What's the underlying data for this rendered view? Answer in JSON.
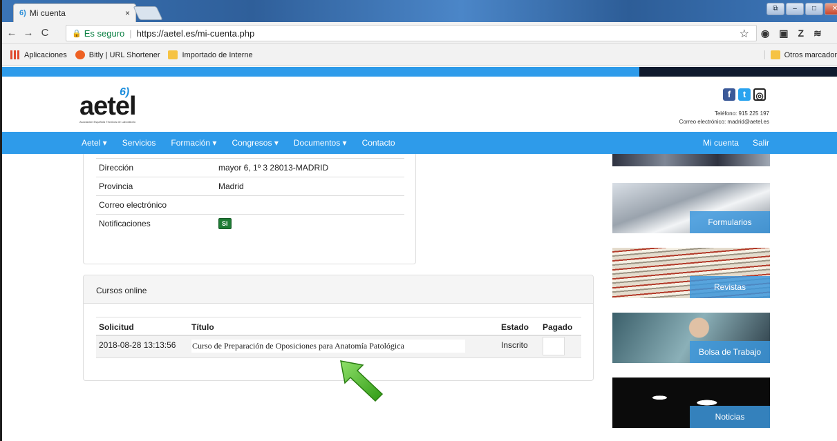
{
  "browser": {
    "tab_title": "Mi cuenta",
    "tab_close": "×",
    "secure_label": "Es seguro",
    "url": "https://aetel.es/mi-cuenta.php",
    "bookmarks": [
      "Aplicaciones",
      "Bitly | URL Shortener",
      "Importado de Interne"
    ],
    "other_bookmarks": "Otros marcador"
  },
  "header": {
    "logo_text": "aetel",
    "logo_mark": "6)",
    "logo_subtitle": "Asociación Española Técnicos de Laboratorio",
    "phone": "Teléfono: 915 225 197",
    "email": "Correo electrónico: madrid@aetel.es"
  },
  "nav": {
    "items": [
      "Aetel ▾",
      "Servicios",
      "Formación ▾",
      "Congresos ▾",
      "Documentos ▾",
      "Contacto"
    ],
    "right": [
      "Mi cuenta",
      "Salir"
    ]
  },
  "profile": {
    "rows": [
      {
        "label": "Dirección",
        "value": "mayor 6, 1º 3 28013-MADRID"
      },
      {
        "label": "Provincia",
        "value": "Madrid"
      },
      {
        "label": "Correo electrónico",
        "value": ""
      },
      {
        "label": "Notificaciones",
        "value": "SI"
      }
    ]
  },
  "courses": {
    "heading": "Cursos online",
    "columns": [
      "Solicitud",
      "Título",
      "Estado",
      "Pagado"
    ],
    "rows": [
      {
        "solicitud": "2018-08-28 13:13:56",
        "titulo": "Curso de Preparación de Oposiciones para  Anatomía Patológica",
        "estado": "Inscrito",
        "pagado": ""
      }
    ]
  },
  "sidebar": {
    "banners": [
      "Formularios",
      "Revistas",
      "Bolsa de Trabajo",
      "Noticias"
    ]
  },
  "colors": {
    "brand_blue": "#2e9bea",
    "badge_green": "#1e7b34",
    "arrow_green": "#3fae1f"
  }
}
